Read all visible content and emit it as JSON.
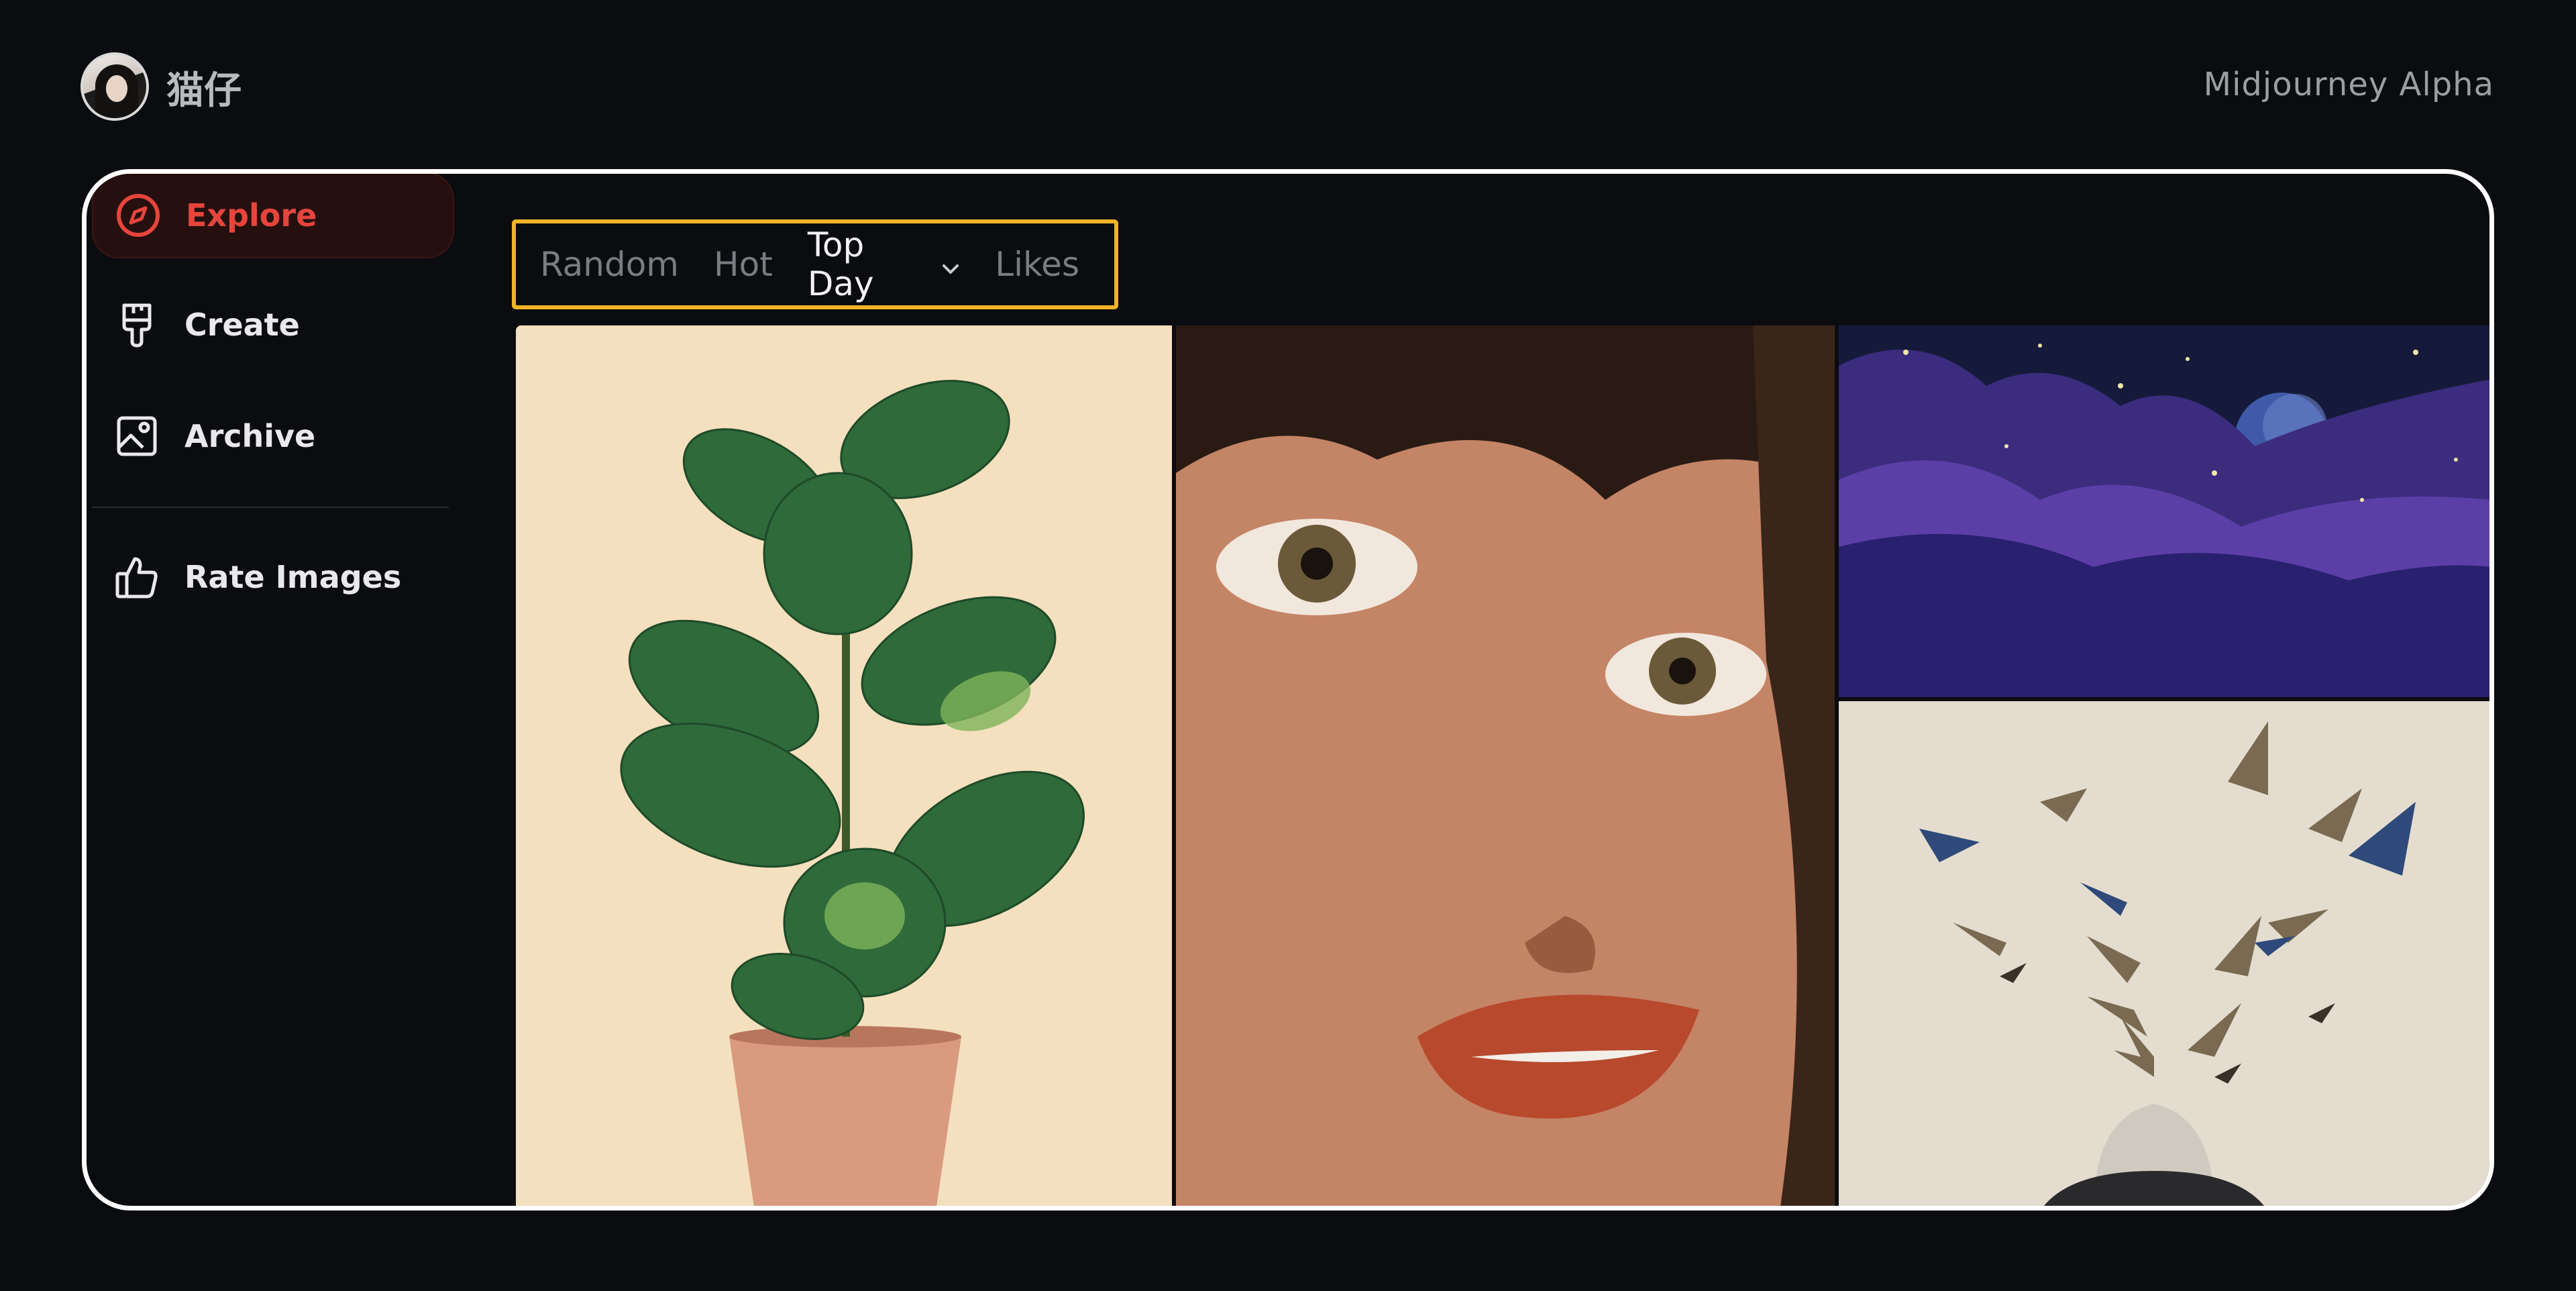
{
  "header": {
    "username": "猫仔",
    "brand": "Midjourney Alpha"
  },
  "sidebar": {
    "items": [
      {
        "label": "Explore",
        "icon": "compass-icon",
        "active": true
      },
      {
        "label": "Create",
        "icon": "paintbrush-icon",
        "active": false
      },
      {
        "label": "Archive",
        "icon": "image-icon",
        "active": false
      },
      {
        "label": "Rate Images",
        "icon": "thumbs-up-icon",
        "active": false
      }
    ]
  },
  "tabs": {
    "items": [
      "Random",
      "Hot",
      "Top Day",
      "Likes"
    ],
    "selected": "Top Day",
    "highlight_color": "#f0b429"
  },
  "gallery": {
    "images": [
      {
        "subject": "fiddle-leaf-fig-plant"
      },
      {
        "subject": "freckled-face-closeup"
      },
      {
        "subject": "purple-night-clouds-moon"
      },
      {
        "subject": "birds-flying-from-head"
      }
    ]
  },
  "colors": {
    "background": "#0b0c0f",
    "accent": "#e6453c",
    "frame": "#ffffff"
  }
}
